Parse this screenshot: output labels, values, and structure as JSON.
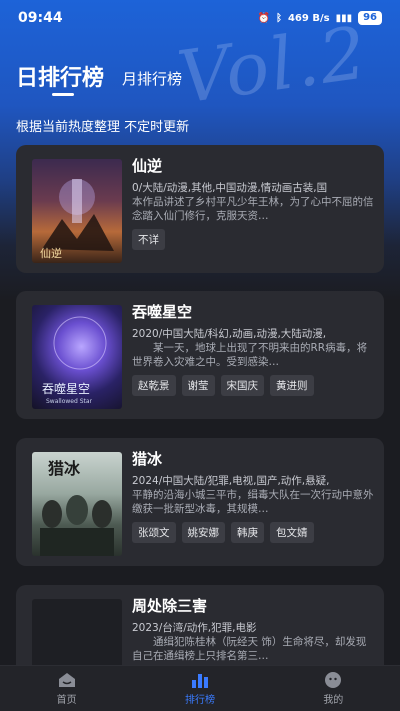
{
  "status_bar": {
    "time": "09:44",
    "network_speed": "469 B/s",
    "battery": "96"
  },
  "tabs": {
    "daily": "日排行榜",
    "monthly": "月排行榜"
  },
  "subtitle": "根据当前热度整理 不定时更新",
  "items": [
    {
      "title": "仙逆",
      "meta": "0/大陆/动漫,其他,中国动漫,情动画古装,国",
      "desc": "本作品讲述了乡村平凡少年王林，为了心中不屈的信念踏入仙门修行，克服天资…",
      "tags": [
        "不详"
      ]
    },
    {
      "title": "吞噬星空",
      "meta": "2020/中国大陆/科幻,动画,动漫,大陆动漫,",
      "desc": "　　某一天，地球上出现了不明来由的RR病毒，将世界卷入灾难之中。受到感染…",
      "tags": [
        "赵乾景",
        "谢莹",
        "宋国庆",
        "黄进则"
      ]
    },
    {
      "title": "猎冰",
      "meta": "2024/中国大陆/犯罪,电视,国产,动作,悬疑,",
      "desc": "平静的沿海小城三平市，缉毒大队在一次行动中意外缴获一批新型冰毒，其规模…",
      "tags": [
        "张颂文",
        "姚安娜",
        "韩庚",
        "包文婧"
      ]
    },
    {
      "title": "周处除三害",
      "meta": "2023/台湾/动作,犯罪,电影",
      "desc": "　　通缉犯陈桂林（阮经天 饰）生命将尽，却发现自己在通缉榜上只排名第三…",
      "tags": []
    }
  ],
  "nav": {
    "home": "首页",
    "ranking": "排行榜",
    "mine": "我的"
  },
  "colors": {
    "accent": "#3a7bff",
    "header_blue": "#1d63d8",
    "card_bg": "#2a2b31"
  },
  "poster_text": {
    "item2": "吞噬星空",
    "item2_sub": "Swallowed Star"
  }
}
